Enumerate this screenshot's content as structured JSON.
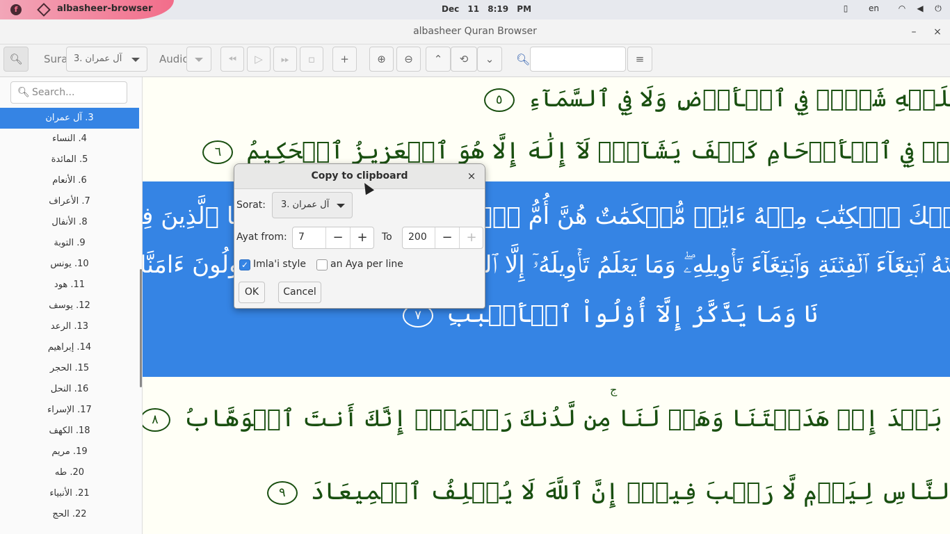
{
  "system_bar": {
    "app_name": "albasheer-browser",
    "date": "Dec 11",
    "time": "8:19 PM",
    "keyboard_layout": "en"
  },
  "window": {
    "title": "albasheer Quran Browser",
    "minimize": "–",
    "close": "×"
  },
  "toolbar": {
    "sura_label": "Sura",
    "sura_value": "3. آل عمران",
    "audio_label": "Audio",
    "search_value": ""
  },
  "sidebar": {
    "search_placeholder": "Search...",
    "suras": [
      "3. آل عمران",
      "4. النساء",
      "5. المائدة",
      "6. الأنعام",
      "7. الأعراف",
      "8. الأنفال",
      "9. التوبة",
      "10. يونس",
      "11. هود",
      "12. يوسف",
      "13. الرعد",
      "14. إبراهيم",
      "15. الحجر",
      "16. النحل",
      "17. الإسراء",
      "18. الكهف",
      "19. مريم",
      "20. طه",
      "21. الأنبياء",
      "22. الحج"
    ],
    "selected_index": 0
  },
  "content": {
    "aya_lines": [
      "عَلَيۡهِ شَيۡءٞ فِي ٱلۡأَرۡضِ وَلَا فِي ٱلسَّمَآءِ",
      "كُمۡ فِي ٱلۡأَرۡحَامِ كَيۡفَ يَشَآءُۚ لَآ إِلَٰهَ إِلَّا هُوَ ٱلۡعَزِيزُ ٱلۡحَكِيمُ",
      "لَيۡكَ ٱلۡكِتَٰبَ مِنۡهُ ءَايَٰتٞ مُّحۡكَمَٰتٌ هُنَّ أُمُّ ٱلۡكِتَٰبِ وَأُخَرُ مُتَشَٰبِهَٰتٞۖ فَأَمَّا ٱلَّذِينَ فِي قُلُوبِهِمۡ زَيۡغٞ",
      "مِنۡهُ ٱبۡتِغَآءَ ٱلۡفِتۡنَةِ وَٱبۡتِغَآءَ تَأۡوِيلِهِۦۖ وَمَا يَعۡلَمُ تَأۡوِيلَهُۥٓ إِلَّا ٱللَّهُۗ وَٱلرَّٰسِخُونَ فِي ٱلۡعِلۡمِ يَقُولُونَ ءَامَنَّا بِهِۦ",
      "نَا وَمَا يَذَّكَّرُ إِلَّآ أُوْلُواْ ٱلۡأَلۡبَٰبِ",
      "نَا بَعۡدَ إِذۡ هَدَيۡتَنَا وَهَبۡ لَنَا مِن لَّدُنكَ رَحۡمَةًۚ إِنَّكَ أَنتَ ٱلۡوَهَّابُ",
      "ٱلنَّاسِ لِيَوۡمٖ لَّا رَيۡبَ فِيهِۚ إِنَّ ٱللَّهَ لَا يُخۡلِفُ ٱلۡمِيعَادَ"
    ],
    "aya_numbers": [
      "٥",
      "٦",
      "٧",
      "٨",
      "٩"
    ],
    "pause_mark": "ج"
  },
  "dialog": {
    "title": "Copy to clipboard",
    "close": "×",
    "sorat_label": "Sorat:",
    "sorat_value": "3. آل عمران",
    "ayat_from_label": "Ayat from:",
    "ayat_from_value": "7",
    "to_label": "To",
    "to_value": "200",
    "minus": "−",
    "plus": "+",
    "imlai_label": "Imla'i style",
    "imlai_checked": true,
    "aya_per_line_label": "an Aya per line",
    "aya_per_line_checked": false,
    "ok_label": "OK",
    "cancel_label": "Cancel"
  },
  "colors": {
    "accent": "#3584e4",
    "quran_text": "#194f10",
    "content_background": "#fffff6"
  }
}
